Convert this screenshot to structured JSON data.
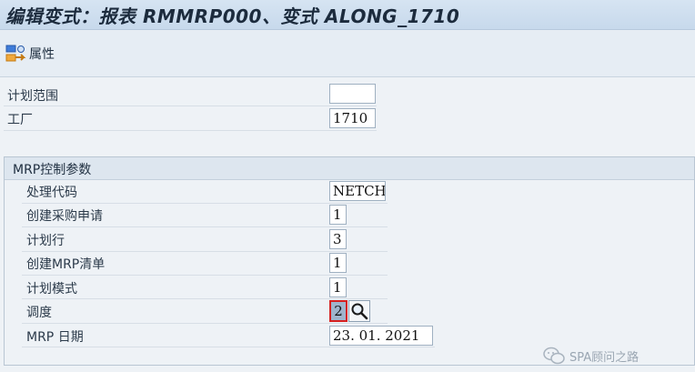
{
  "window": {
    "title": "编辑变式：报表 RMMRP000、变式 ALONG_1710"
  },
  "toolbar": {
    "attributes_label": "属性"
  },
  "selection": {
    "planning_scope_label": "计划范围",
    "planning_scope_value": "",
    "plant_label": "工厂",
    "plant_value": "1710"
  },
  "mrp_group": {
    "title": "MRP控制参数",
    "rows": [
      {
        "label": "处理代码",
        "value": "NETCH"
      },
      {
        "label": "创建采购申请",
        "value": "1"
      },
      {
        "label": "计划行",
        "value": "3"
      },
      {
        "label": "创建MRP清单",
        "value": "1"
      },
      {
        "label": "计划模式",
        "value": "1"
      },
      {
        "label": "调度",
        "value": "2"
      },
      {
        "label": "MRP 日期",
        "value": "23. 01. 2021"
      }
    ]
  },
  "watermark": {
    "text": "SPA顾问之路"
  },
  "colors": {
    "title_bar": "#c7d9ec",
    "focus_border": "#d62020",
    "selected_field": "#9fb4cc"
  },
  "icons": {
    "attributes": "attributes-icon",
    "value_help": "magnifier-icon",
    "watermark": "wechat-icon"
  }
}
